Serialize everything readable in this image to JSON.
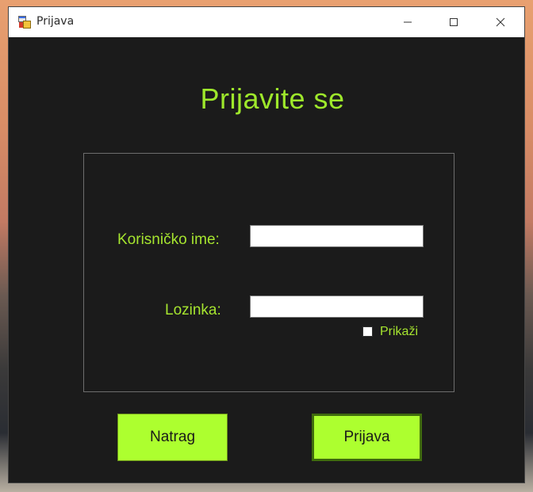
{
  "window": {
    "title": "Prijava",
    "icon": "app-form-icon"
  },
  "titlebar_controls": {
    "minimize_icon": "minimize-icon",
    "maximize_icon": "maximize-icon",
    "close_icon": "close-icon"
  },
  "form": {
    "heading": "Prijavite se",
    "username_label": "Korisničko ime:",
    "username_value": "",
    "password_label": "Lozinka:",
    "password_value": "",
    "show_password_label": "Prikaži",
    "show_password_checked": false
  },
  "buttons": {
    "back_label": "Natrag",
    "login_label": "Prijava"
  },
  "colors": {
    "background": "#1b1b1b",
    "accent": "#adff2f",
    "label_text": "#a6e52f"
  }
}
